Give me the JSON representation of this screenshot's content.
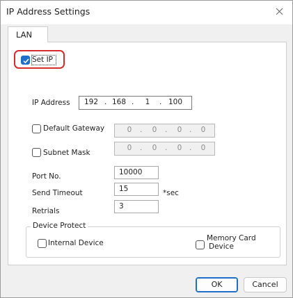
{
  "window": {
    "title": "IP Address Settings"
  },
  "tabs": [
    {
      "label": "LAN"
    }
  ],
  "set_ip": {
    "label": "Set IP",
    "checked": true
  },
  "ip_address": {
    "label": "IP Address",
    "octets": [
      "192",
      "168",
      "1",
      "100"
    ]
  },
  "default_gateway": {
    "label": "Default Gateway",
    "checked": false,
    "octets": [
      "0",
      "0",
      "0",
      "0"
    ]
  },
  "subnet_mask": {
    "label": "Subnet Mask",
    "checked": false,
    "octets": [
      "0",
      "0",
      "0",
      "0"
    ]
  },
  "port": {
    "label": "Port No.",
    "value": "10000"
  },
  "send_timeout": {
    "label": "Send Timeout",
    "value": "15",
    "unit": "*sec"
  },
  "retrials": {
    "label": "Retrials",
    "value": "3"
  },
  "device_protect": {
    "title": "Device Protect",
    "internal_device": {
      "label": "Internal Device",
      "checked": false
    },
    "memory_card": {
      "label_line1": "Memory Card",
      "label_line2": "Device",
      "checked": false
    }
  },
  "buttons": {
    "ok": "OK",
    "cancel": "Cancel"
  },
  "colors": {
    "accent": "#1d6fc9",
    "highlight": "#d62b2b",
    "window_bg": "#f0f0f0"
  }
}
